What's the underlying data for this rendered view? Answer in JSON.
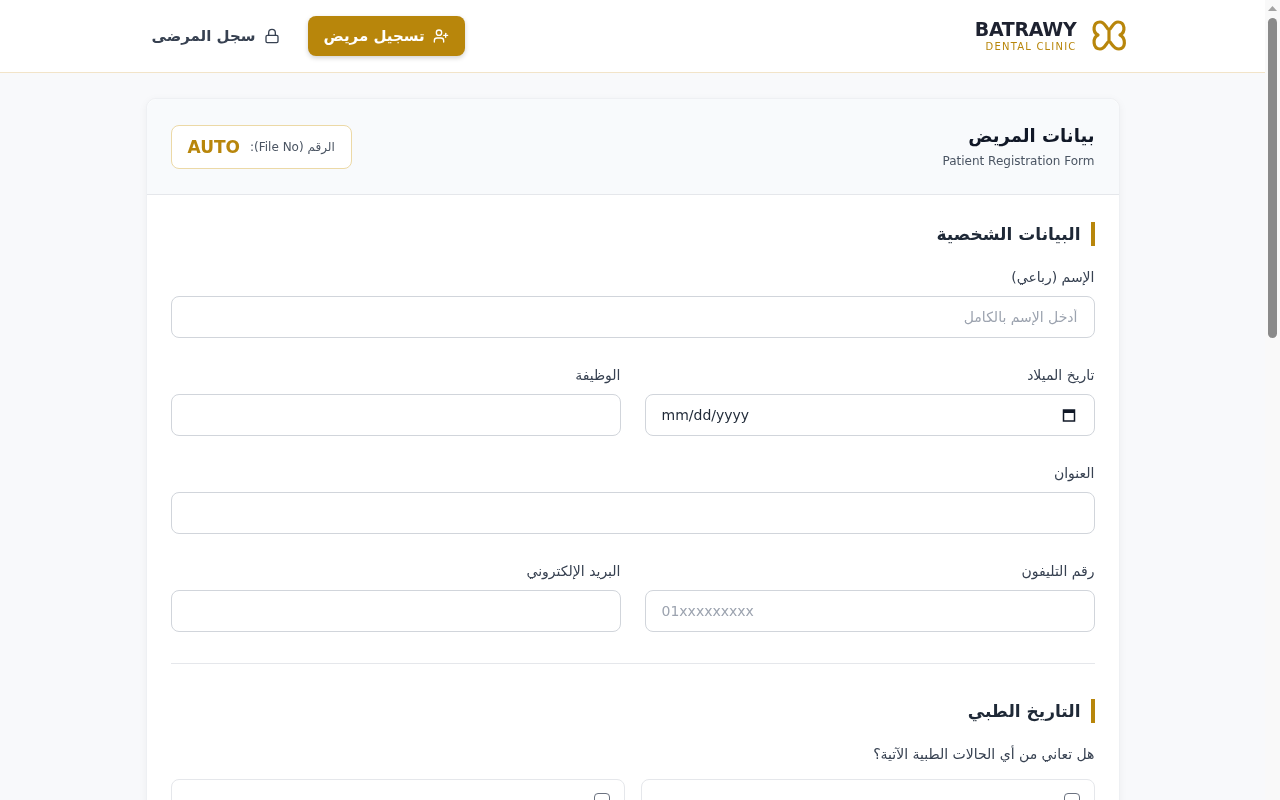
{
  "header": {
    "logo": {
      "name": "BATRAWY",
      "tagline": "DENTAL CLINIC"
    },
    "nav": [
      {
        "label": "تسجيل مريض",
        "selected": true
      },
      {
        "label": "سجل المرضى",
        "selected": false
      }
    ]
  },
  "form": {
    "title": "بيانات المريض",
    "subtitle": "Patient Registration Form",
    "file_number": {
      "label": "الرقم (File No):",
      "value": "AUTO"
    },
    "personal": {
      "title": "البيانات الشخصية",
      "rows": [
        [
          {
            "label": "الإسم (رباعي)",
            "kind": "text",
            "placeholder": "أدخل الإسم بالكامل"
          }
        ],
        [
          {
            "label": "تاريخ الميلاد",
            "kind": "date",
            "placeholder": "mm/dd/yyyy"
          },
          {
            "label": "الوظيفة",
            "kind": "text"
          }
        ],
        [
          {
            "label": "العنوان",
            "kind": "text"
          }
        ],
        [
          {
            "label": "رقم التليفون",
            "kind": "phone",
            "placeholder": "01xxxxxxxxx"
          },
          {
            "label": "البريد الإلكتروني",
            "kind": "text"
          }
        ]
      ]
    },
    "medical": {
      "title": "التاريخ الطبي",
      "question": "هل تعاني من أي الحالات الطبية الآتية؟",
      "conditions": [
        {
          "checked": false
        },
        {
          "checked": false
        }
      ]
    }
  }
}
